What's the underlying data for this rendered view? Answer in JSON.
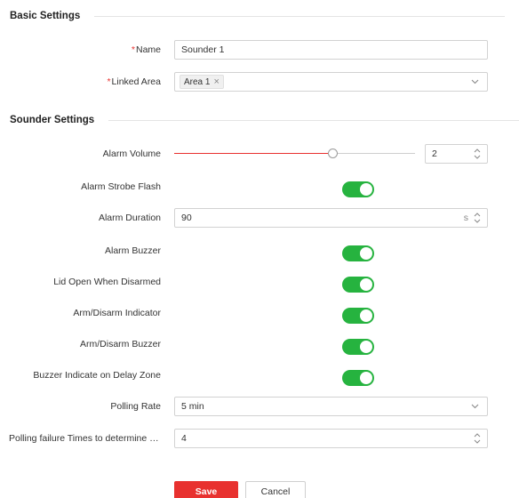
{
  "basic_settings": {
    "title": "Basic Settings",
    "name": {
      "required_mark": "*",
      "label": "Name",
      "value": "Sounder 1"
    },
    "linked_area": {
      "required_mark": "*",
      "label": "Linked Area",
      "tag": "Area 1",
      "tag_close": "×"
    }
  },
  "sounder_settings": {
    "title": "Sounder Settings",
    "alarm_volume": {
      "label": "Alarm Volume",
      "value": "2",
      "level": 0.66
    },
    "alarm_strobe_flash": {
      "label": "Alarm Strobe Flash",
      "on": true
    },
    "alarm_duration": {
      "label": "Alarm Duration",
      "value": "90",
      "unit": "s"
    },
    "alarm_buzzer": {
      "label": "Alarm Buzzer",
      "on": true
    },
    "lid_open_when_disarmed": {
      "label": "Lid Open When Disarmed",
      "on": true
    },
    "arm_disarm_indicator": {
      "label": "Arm/Disarm Indicator",
      "on": true
    },
    "arm_disarm_buzzer": {
      "label": "Arm/Disarm Buzzer",
      "on": true
    },
    "buzzer_indicate_delay_zone": {
      "label": "Buzzer Indicate on Delay Zone",
      "on": true
    },
    "polling_rate": {
      "label": "Polling Rate",
      "value": "5 min"
    },
    "polling_failure_times": {
      "label": "Polling failure Times to determine of...",
      "value": "4"
    }
  },
  "actions": {
    "save_label": "Save",
    "cancel_label": "Cancel"
  },
  "colors": {
    "accent": "#e8312f",
    "toggle_on": "#26b33f"
  },
  "icons": {
    "dropdown": "chevron-down-icon",
    "stepper": "stepper-icon",
    "tag_remove": "close-icon"
  }
}
